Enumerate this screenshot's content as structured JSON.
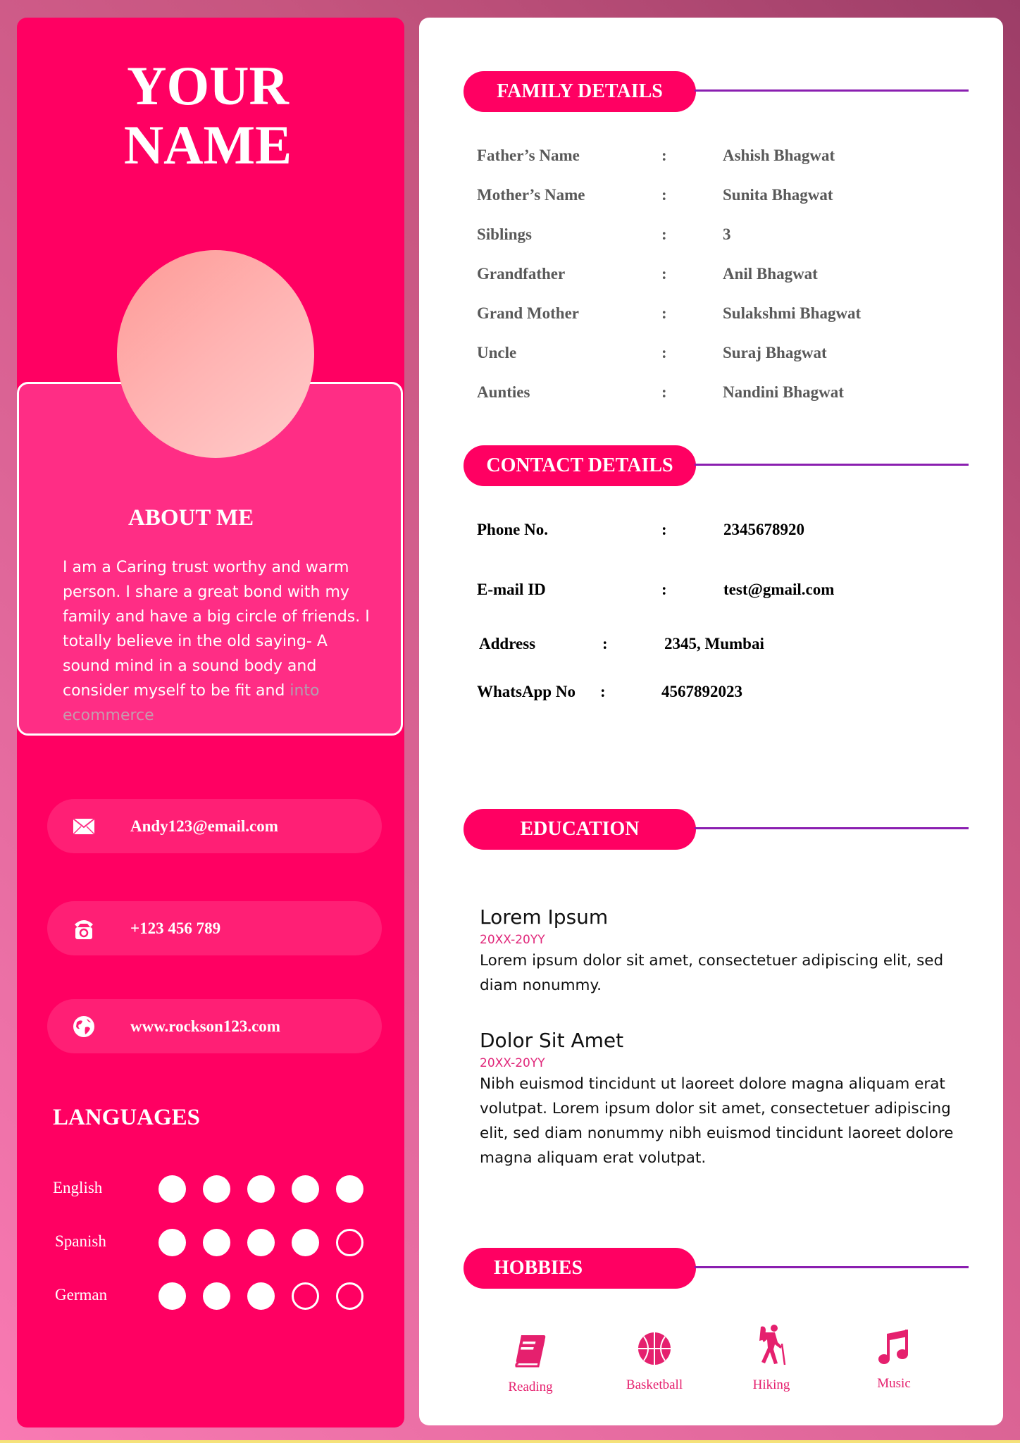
{
  "profile": {
    "name_line1": "YOUR",
    "name_line2": "NAME"
  },
  "about": {
    "title": "ABOUT ME",
    "text_visible": "I am a Caring trust worthy and warm person. I share a great bond with my family and have a big circle of friends. I totally believe in the old saying- A sound mind in a sound body and consider myself to be fit and ",
    "text_faded": "into",
    "text_cut": "ecommerce"
  },
  "contacts": [
    {
      "icon": "envelope-icon",
      "value": "Andy123@email.com"
    },
    {
      "icon": "telephone-icon",
      "value": "+123 456 789"
    },
    {
      "icon": "globe-icon",
      "value": "www.rockson123.com"
    }
  ],
  "languages": {
    "title": "LANGUAGES",
    "items": [
      {
        "name": "English",
        "level": 5,
        "max": 5
      },
      {
        "name": "Spanish",
        "level": 4,
        "max": 5
      },
      {
        "name": "German",
        "level": 3,
        "max": 5
      }
    ]
  },
  "family": {
    "title": "FAMILY DETAILS",
    "separator": ":",
    "rows": [
      {
        "label": "Father’s Name",
        "value": "Ashish Bhagwat"
      },
      {
        "label": "Mother’s Name",
        "value": "Sunita Bhagwat"
      },
      {
        "label": "Siblings",
        "value": "3"
      },
      {
        "label": "Grandfather",
        "value": "Anil Bhagwat"
      },
      {
        "label": "Grand Mother",
        "value": "Sulakshmi Bhagwat"
      },
      {
        "label": "Uncle",
        "value": "Suraj Bhagwat"
      },
      {
        "label": "Aunties",
        "value": "Nandini Bhagwat"
      }
    ]
  },
  "contact_details": {
    "title": "CONTACT DETAILS",
    "separator": ":",
    "rows": [
      {
        "label": "Phone No.",
        "value": "2345678920"
      },
      {
        "label": "E-mail ID",
        "value": "test@gmail.com"
      },
      {
        "label": "Address",
        "value": "2345, Mumbai"
      },
      {
        "label": "WhatsApp No",
        "value": "4567892023"
      }
    ]
  },
  "education": {
    "title": "EDUCATION",
    "items": [
      {
        "title": "Lorem Ipsum",
        "date": "20XX-20YY",
        "desc": "Lorem ipsum dolor sit amet, consectetuer adipiscing elit, sed diam nonummy."
      },
      {
        "title": "Dolor Sit Amet",
        "date": "20XX-20YY",
        "desc": "Nibh euismod tincidunt ut laoreet dolore magna aliquam erat volutpat. Lorem ipsum dolor sit amet, consectetuer adipiscing elit, sed diam nonummy nibh euismod tincidunt laoreet dolore magna aliquam erat volutpat."
      }
    ]
  },
  "hobbies": {
    "title": "HOBBIES",
    "items": [
      {
        "icon": "book-icon",
        "label": "Reading"
      },
      {
        "icon": "basketball-icon",
        "label": "Basketball"
      },
      {
        "icon": "hiker-icon",
        "label": "Hiking"
      },
      {
        "icon": "music-note-icon",
        "label": "Music"
      }
    ]
  },
  "colors": {
    "primary_pink": "#ff0062",
    "about_pink": "#ff2d85",
    "divider_purple": "#8a1fb0",
    "hobby_pink": "#e5206e",
    "date_pink": "#e0277a"
  }
}
